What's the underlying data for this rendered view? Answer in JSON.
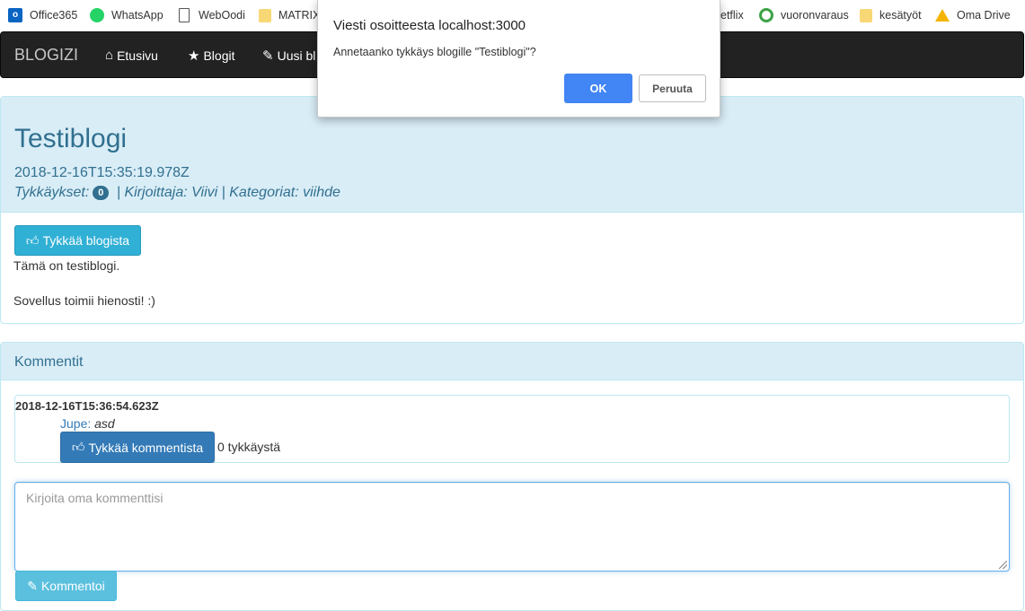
{
  "bookmarks": [
    {
      "label": "Office365",
      "icon": "outlook-icon"
    },
    {
      "label": "WhatsApp",
      "icon": "whatsapp-icon"
    },
    {
      "label": "WebOodi",
      "icon": "page-icon"
    },
    {
      "label": "MATRIX",
      "icon": "folder-icon"
    },
    {
      "label": "etflix",
      "icon": "netflix-icon"
    },
    {
      "label": "vuoronvaraus",
      "icon": "vuoronvaraus-icon"
    },
    {
      "label": "kesätyöt",
      "icon": "folder-icon"
    },
    {
      "label": "Oma Drive",
      "icon": "drive-icon"
    }
  ],
  "navbar": {
    "brand": "BLOGIZI",
    "links": [
      {
        "label": "Etusivu",
        "icon": "home-icon"
      },
      {
        "label": "Blogit",
        "icon": "star-icon"
      },
      {
        "label": "Uusi bl",
        "icon": "pencil-icon"
      }
    ]
  },
  "blog": {
    "title": "Testiblogi",
    "date": "2018-12-16T15:35:19.978Z",
    "likes_label": "Tykkäykset:",
    "likes_count": "0",
    "author_label": " | Kirjoittaja: ",
    "author": "Viivi",
    "categories_label": " | Kategoriat: ",
    "categories": "viihde",
    "like_button": "Tykkää blogista",
    "body_line1": "Tämä on testiblogi.",
    "body_line2": "Sovellus toimii hienosti! :)"
  },
  "comments": {
    "heading": "Kommentit",
    "items": [
      {
        "date": "2018-12-16T15:36:54.623Z",
        "author": "Jupe:",
        "text": "asd",
        "like_button": "Tykkää kommentista",
        "likes": "0 tykkäystä"
      }
    ],
    "input_placeholder": "Kirjoita oma kommenttisi",
    "submit_button": "Kommentoi"
  },
  "dialog": {
    "title": "Viesti osoitteesta localhost:3000",
    "message": "Annetaanko tykkäys blogille \"Testiblogi\"?",
    "ok": "OK",
    "cancel": "Peruuta"
  },
  "colors": {
    "navbar_bg": "#222222",
    "panel_heading_bg": "#d9edf7",
    "panel_heading_text": "#31708f",
    "dialog_ok": "#4285f4",
    "btn_info": "#31b0d5",
    "btn_primary": "#337ab7"
  }
}
